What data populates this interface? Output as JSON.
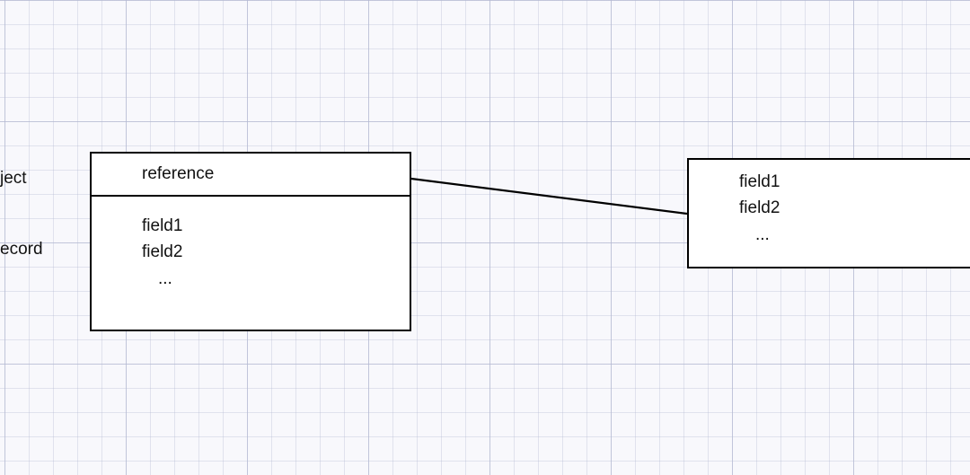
{
  "labels": {
    "object": "ject",
    "record": "ecord"
  },
  "box1": {
    "title": "reference",
    "fields": [
      "field1",
      "field2",
      "..."
    ]
  },
  "box2": {
    "fields": [
      "field1",
      "field2",
      "..."
    ]
  }
}
